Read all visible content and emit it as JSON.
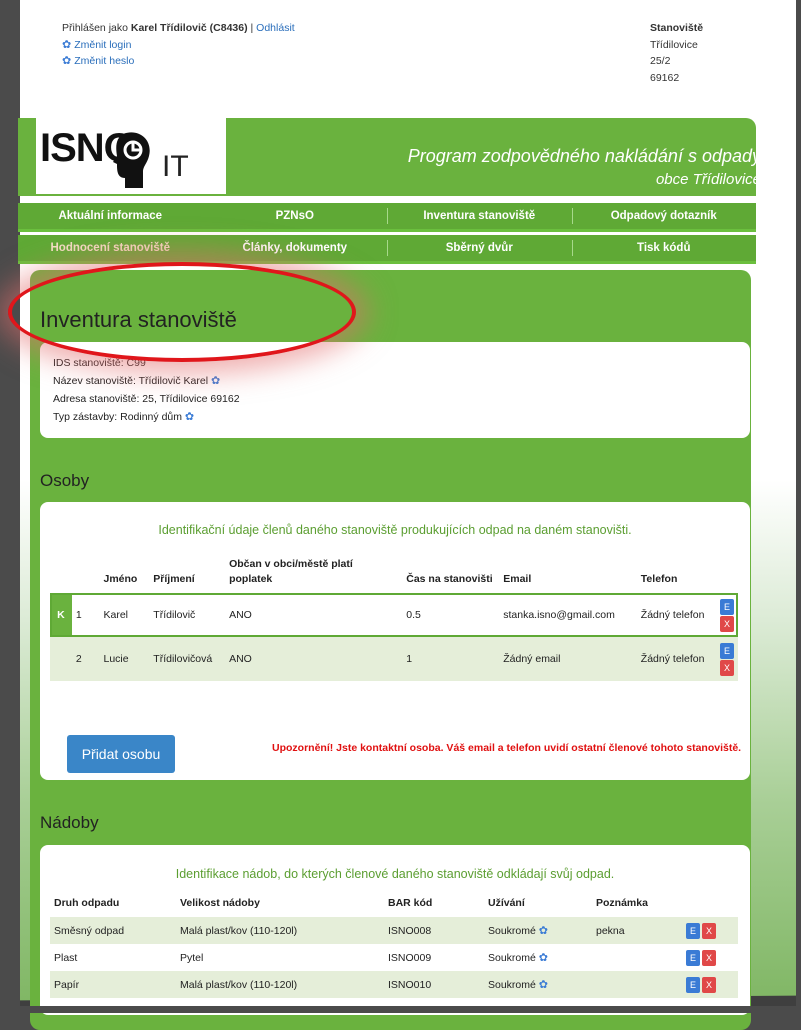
{
  "header": {
    "logged_prefix": "Přihlášen jako",
    "user_name": "Karel Třídilovič (C8436)",
    "separator": "|",
    "logout": "Odhlásit",
    "change_login": "Změnit login",
    "change_password": "Změnit heslo",
    "site_title": "Stanoviště",
    "site_line1": "Třídilovice",
    "site_line2": "25/2",
    "site_line3": "69162"
  },
  "logo": {
    "text": "ISNO",
    "suffix": "IT"
  },
  "slogan": {
    "line1": "Program zodpovědného nakládání s odpady",
    "line2": "obce Třídilovice"
  },
  "nav": {
    "row1": [
      "Aktuální informace",
      "PZNsO",
      "Inventura stanoviště",
      "Odpadový dotazník"
    ],
    "row2": [
      "Hodnocení stanoviště",
      "Články, dokumenty",
      "Sběrný dvůr",
      "Tisk kódů"
    ]
  },
  "page_title": "Inventura stanoviště",
  "site_info": {
    "ids": "IDS stanoviště: C99",
    "name_label": "Název stanoviště:",
    "name_value": "Třídilovič Karel",
    "address": "Adresa stanoviště: 25, Třídilovice 69162",
    "type_label": "Typ zástavby:",
    "type_value": "Rodinný dům"
  },
  "persons": {
    "section_title": "Osoby",
    "caption": "Identifikační údaje členů daného stanoviště produkujících odpad na daném stanovišti.",
    "headers": [
      "Jméno",
      "Příjmení",
      "Občan v obci/městě platí poplatek",
      "Čas na stanovišti",
      "Email",
      "Telefon"
    ],
    "rows": [
      {
        "badge": "K",
        "num": "1",
        "first": "Karel",
        "last": "Třídilovič",
        "citizen": "ANO",
        "time": "0.5",
        "email": "stanka.isno@gmail.com",
        "phone": "Žádný telefon"
      },
      {
        "badge": "",
        "num": "2",
        "first": "Lucie",
        "last": "Třídilovičová",
        "citizen": "ANO",
        "time": "1",
        "email": "Žádný email",
        "phone": "Žádný telefon"
      }
    ],
    "edit_label": "E",
    "delete_label": "X",
    "add_button": "Přidat osobu",
    "warning": "Upozornění! Jste kontaktní osoba. Váš email a telefon uvidí ostatní členové tohoto stanoviště."
  },
  "bins": {
    "section_title": "Nádoby",
    "caption": "Identifikace nádob, do kterých členové daného stanoviště odkládají svůj odpad.",
    "headers": [
      "Druh odpadu",
      "Velikost nádoby",
      "BAR kód",
      "Užívání",
      "Poznámka"
    ],
    "rows": [
      {
        "type": "Směsný odpad",
        "size": "Malá plast/kov (110-120l)",
        "code": "ISNO008",
        "usage": "Soukromé",
        "note": "pekna"
      },
      {
        "type": "Plast",
        "size": "Pytel",
        "code": "ISNO009",
        "usage": "Soukromé",
        "note": ""
      },
      {
        "type": "Papír",
        "size": "Malá plast/kov (110-120l)",
        "code": "ISNO010",
        "usage": "Soukromé",
        "note": ""
      }
    ]
  },
  "colors": {
    "green": "#6ab23e",
    "blue": "#3a7bd5",
    "red": "#e01010"
  }
}
